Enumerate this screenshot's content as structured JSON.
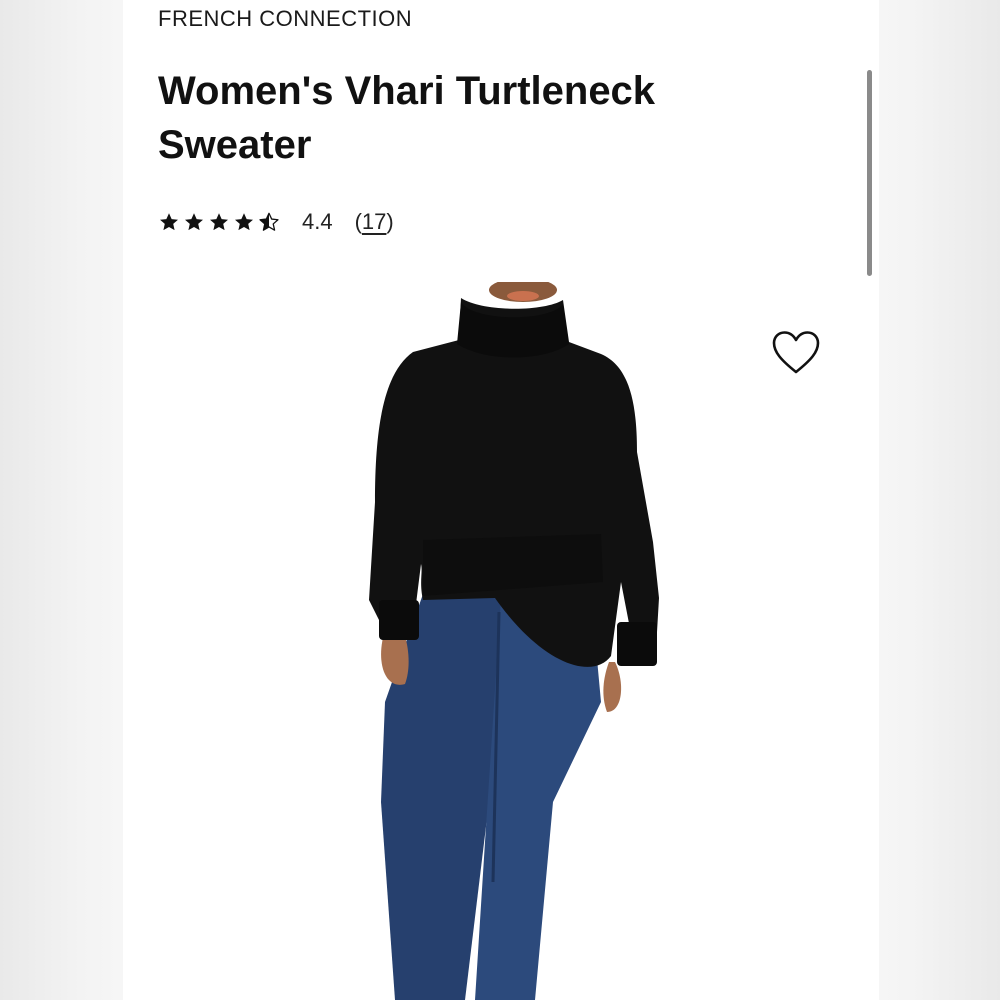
{
  "product": {
    "brand": "FRENCH CONNECTION",
    "title": "Women's Vhari Turtleneck Sweater",
    "rating": {
      "stars_filled": 4,
      "stars_half": 1,
      "value": "4.4",
      "count_open": "(",
      "count": "17",
      "count_close": ")"
    },
    "image": {
      "icon": "sweater-model-photo",
      "sweater_color": "#111111",
      "jeans_color": "#26406e"
    }
  },
  "actions": {
    "favorite_icon": "heart-outline-icon"
  }
}
